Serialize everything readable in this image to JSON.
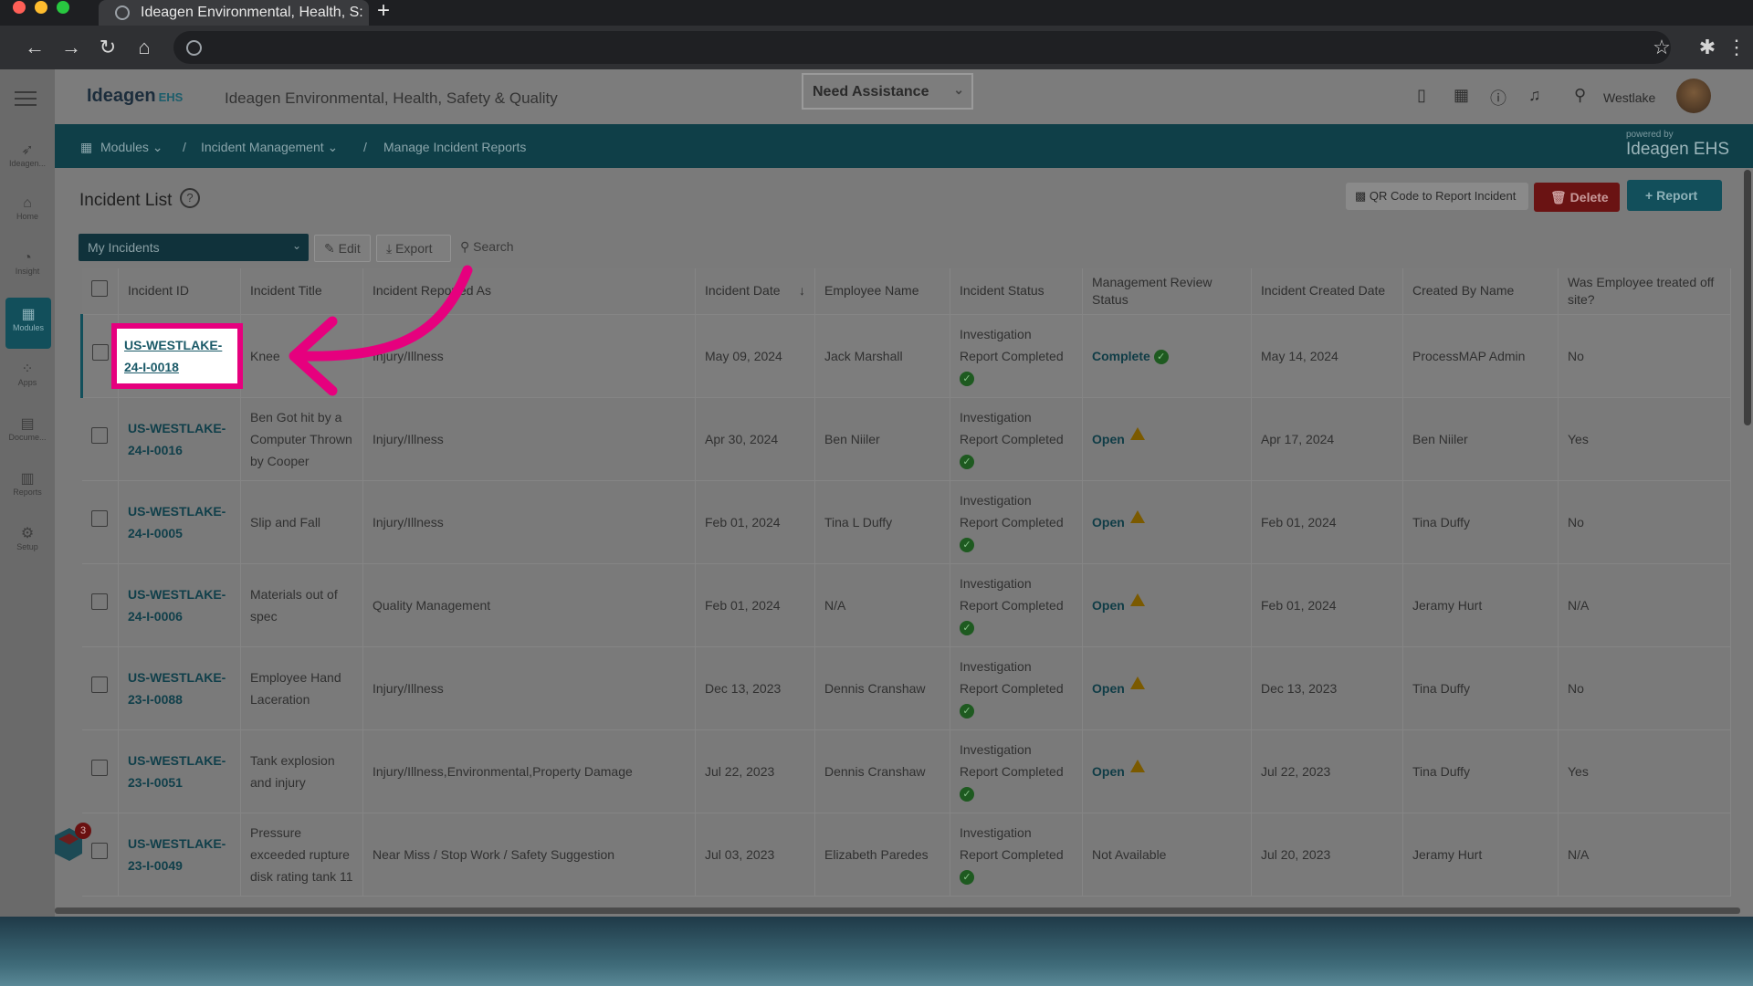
{
  "browser": {
    "tab_title": "Ideagen Environmental, Health, S:",
    "new_tab_icon": "plus-icon"
  },
  "app": {
    "logo_text": "Ideagen",
    "logo_sub": "EHS",
    "title": "Ideagen Environmental, Health, Safety & Quality",
    "assist_label": "Need Assistance",
    "location": "Westlake"
  },
  "sidebar": {
    "items": [
      {
        "label": "Ideagen...",
        "icon": "ideagen-icon"
      },
      {
        "label": "Home",
        "icon": "home-icon"
      },
      {
        "label": "Insight",
        "icon": "insight-icon"
      },
      {
        "label": "Modules",
        "icon": "modules-icon",
        "active": true
      },
      {
        "label": "Apps",
        "icon": "apps-icon"
      },
      {
        "label": "Docume...",
        "icon": "documents-icon"
      },
      {
        "label": "Reports",
        "icon": "reports-icon"
      },
      {
        "label": "Setup",
        "icon": "setup-icon"
      }
    ]
  },
  "breadcrumb": {
    "modules": "Modules",
    "incident_management": "Incident Management",
    "current": "Manage Incident Reports",
    "powered_by": "powered by",
    "powered_brand": "Ideagen EHS"
  },
  "list": {
    "title": "Incident List",
    "qr_label": "QR Code to Report Incident",
    "delete_label": "Delete",
    "report_label": "Report",
    "filter_value": "My Incidents",
    "edit_label": "Edit",
    "export_label": "Export",
    "search_label": "Search"
  },
  "table": {
    "headers": [
      "Incident ID",
      "Incident Title",
      "Incident Reported As",
      "Incident Date",
      "Employee Name",
      "Incident Status",
      "Management Review Status",
      "Incident Created Date",
      "Created By Name",
      "Was Employee treated off site?"
    ],
    "rows": [
      {
        "id1": "US-WESTLAKE-",
        "id2": "24-I-0018",
        "title": "Knee",
        "reported": "Injury/Illness",
        "date": "May 09, 2024",
        "employee": "Jack Marshall",
        "status1": "Investigation",
        "status2": "Report Completed",
        "review": "Complete",
        "created": "May 14, 2024",
        "by": "ProcessMAP Admin",
        "offsite": "No"
      },
      {
        "id1": "US-WESTLAKE-",
        "id2": "24-I-0016",
        "title": "Ben Got hit by a Computer Thrown by Cooper",
        "reported": "Injury/Illness",
        "date": "Apr 30, 2024",
        "employee": "Ben Niiler",
        "status1": "Investigation",
        "status2": "Report Completed",
        "review": "Open",
        "created": "Apr 17, 2024",
        "by": "Ben Niiler",
        "offsite": "Yes"
      },
      {
        "id1": "US-WESTLAKE-",
        "id2": "24-I-0005",
        "title": "Slip and Fall",
        "reported": "Injury/Illness",
        "date": "Feb 01, 2024",
        "employee": "Tina L Duffy",
        "status1": "Investigation",
        "status2": "Report Completed",
        "review": "Open",
        "created": "Feb 01, 2024",
        "by": "Tina Duffy",
        "offsite": "No"
      },
      {
        "id1": "US-WESTLAKE-",
        "id2": "24-I-0006",
        "title": "Materials out of spec",
        "reported": "Quality Management",
        "date": "Feb 01, 2024",
        "employee": "N/A",
        "status1": "Investigation",
        "status2": "Report Completed",
        "review": "Open",
        "created": "Feb 01, 2024",
        "by": "Jeramy Hurt",
        "offsite": "N/A"
      },
      {
        "id1": "US-WESTLAKE-",
        "id2": "23-I-0088",
        "title": "Employee Hand Laceration",
        "reported": "Injury/Illness",
        "date": "Dec 13, 2023",
        "employee": "Dennis Cranshaw",
        "status1": "Investigation",
        "status2": "Report Completed",
        "review": "Open",
        "created": "Dec 13, 2023",
        "by": "Tina Duffy",
        "offsite": "No"
      },
      {
        "id1": "US-WESTLAKE-",
        "id2": "23-I-0051",
        "title": "Tank explosion and injury",
        "reported": "Injury/Illness,Environmental,Property Damage",
        "date": "Jul 22, 2023",
        "employee": "Dennis Cranshaw",
        "status1": "Investigation",
        "status2": "Report Completed",
        "review": "Open",
        "created": "Jul 22, 2023",
        "by": "Tina Duffy",
        "offsite": "Yes"
      },
      {
        "id1": "US-WESTLAKE-",
        "id2": "23-I-0049",
        "title": "Pressure exceeded rupture disk rating tank 11",
        "reported": "Near Miss / Stop Work / Safety Suggestion",
        "date": "Jul 03, 2023",
        "employee": "Elizabeth Paredes",
        "status1": "Investigation",
        "status2": "Report Completed",
        "review": "Not Available",
        "created": "Jul 20, 2023",
        "by": "Jeramy Hurt",
        "offsite": "N/A"
      }
    ]
  },
  "fab_badge": "3",
  "colors": {
    "highlight": "#e6007e",
    "teal": "#124f5b",
    "delete": "#6a1313"
  }
}
